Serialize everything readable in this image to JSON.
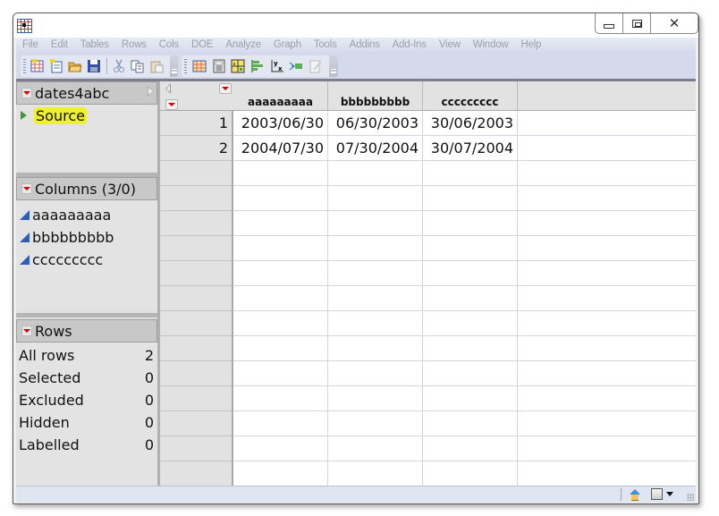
{
  "window": {
    "title": "",
    "buttons": {
      "minimize": "minimize",
      "restore": "restore",
      "close": "close"
    }
  },
  "menu": [
    "File",
    "Edit",
    "Tables",
    "Rows",
    "Cols",
    "DOE",
    "Analyze",
    "Graph",
    "Tools",
    "Addins",
    "Add-Ins",
    "View",
    "Window",
    "Help"
  ],
  "toolbar": {
    "group1": [
      "new-data-table-icon",
      "new-script-icon",
      "open-folder-icon",
      "save-icon",
      "cut-icon",
      "copy-icon",
      "paste-icon"
    ],
    "group2": [
      "data-table-icon",
      "calculator-icon",
      "distribution-icon",
      "bar-chart-icon",
      "fit-y-by-x-icon",
      "filter-icon",
      "edit-icon"
    ]
  },
  "table_panel": {
    "title": "dates4abc",
    "items": [
      {
        "label": "Source",
        "highlight": "#eef02a"
      }
    ]
  },
  "columns_panel": {
    "title": "Columns (3/0)",
    "columns": [
      "aaaaaaaaa",
      "bbbbbbbbb",
      "ccccccccc"
    ]
  },
  "rows_panel": {
    "title": "Rows",
    "stats": [
      {
        "label": "All rows",
        "value": "2"
      },
      {
        "label": "Selected",
        "value": "0"
      },
      {
        "label": "Excluded",
        "value": "0"
      },
      {
        "label": "Hidden",
        "value": "0"
      },
      {
        "label": "Labelled",
        "value": "0"
      }
    ]
  },
  "grid": {
    "headers": [
      "aaaaaaaaa",
      "bbbbbbbbb",
      "ccccccccc"
    ],
    "rows": [
      {
        "num": "1",
        "cells": [
          "2003/06/30",
          "06/30/2003",
          "30/06/2003"
        ]
      },
      {
        "num": "2",
        "cells": [
          "2004/07/30",
          "07/30/2004",
          "30/07/2004"
        ]
      }
    ]
  },
  "colors": {
    "accent_red": "#dd0000",
    "continuous_blue": "#2d5fb8",
    "source_green": "#3c9a3c"
  }
}
